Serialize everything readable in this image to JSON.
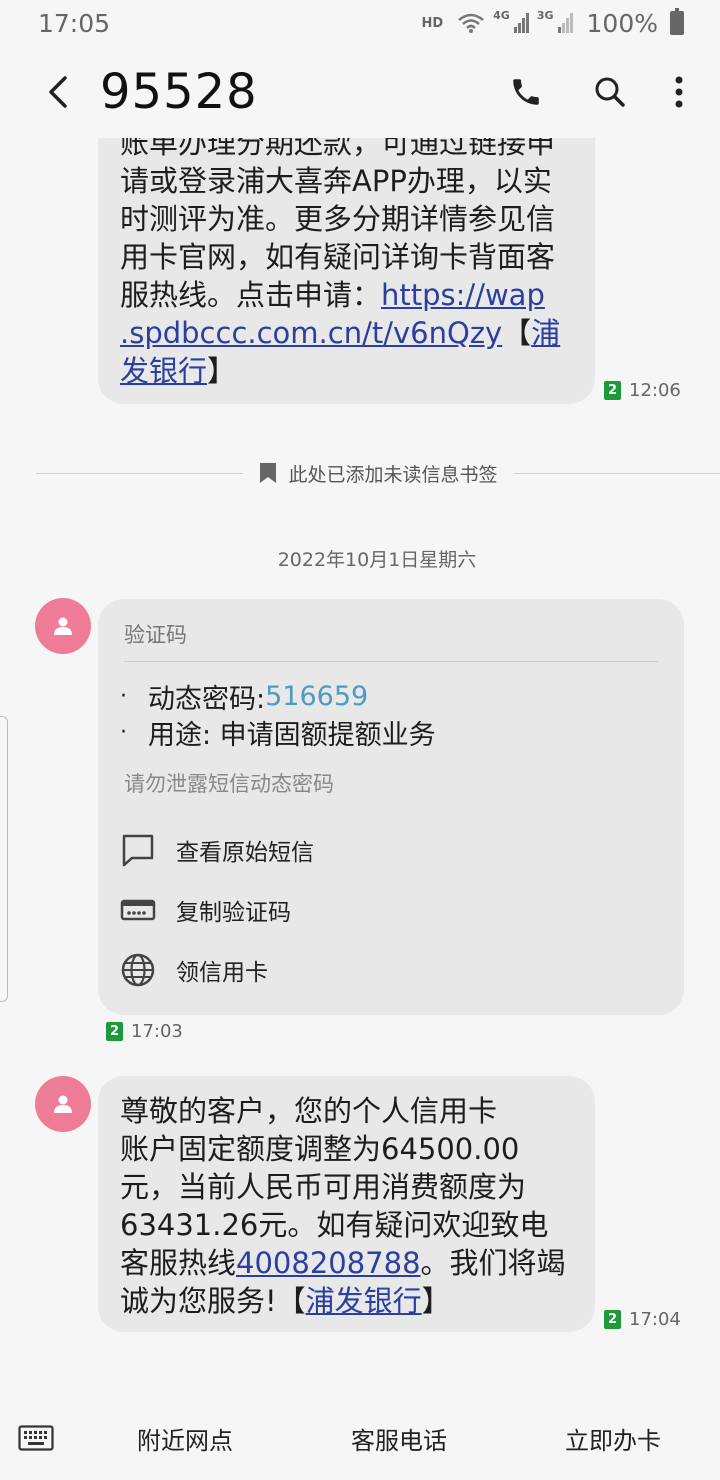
{
  "status": {
    "time": "17:05",
    "hd": "HD",
    "net1": "4G",
    "net2": "3G",
    "battery": "100%"
  },
  "header": {
    "title": "95528"
  },
  "messages": {
    "first": {
      "lines": [
        "账单办理分期还款，可通过链接申",
        "请或登录浦大喜奔APP办理，以实",
        "时测评为准。更多分期详情参见信",
        "用卡官网，如有疑问详询卡背面客",
        "服热线。点击申请："
      ],
      "link1": "https://wap",
      "link2": ".spdbccc.com.cn/t/v6nQzy",
      "bracket_open": "【",
      "bank": "浦发银行",
      "bank_a": "浦",
      "bank_b": "发银行",
      "bracket_close": "】",
      "sim": "2",
      "time": "12:06"
    },
    "bookmark": "此处已添加未读信息书签",
    "date": "2022年10月1日星期六",
    "card": {
      "header": "验证码",
      "items": [
        {
          "label": "动态密码: ",
          "value": "516659"
        },
        {
          "label": "用途: 申请固额提额业务",
          "value": ""
        }
      ],
      "warning": "请勿泄露短信动态密码",
      "actions": [
        "查看原始短信",
        "复制验证码",
        "领信用卡"
      ],
      "sim": "2",
      "time": "17:03"
    },
    "last": {
      "line1": "尊敬的客户，您的个人信用卡",
      "line2": "账户固定额度调整为64500.00",
      "line3": "元，当前人民币可用消费额度为",
      "line4": "63431.26元。如有疑问欢迎致电",
      "line5a": "客服热线",
      "phone": "4008208788",
      "line5b": "。我们将竭",
      "line6a": "诚为您服务!【",
      "bank": "浦发银行",
      "line6b": "】",
      "sim": "2",
      "time": "17:04"
    }
  },
  "bottom": {
    "items": [
      "附近网点",
      "客服电话",
      "立即办卡"
    ]
  }
}
